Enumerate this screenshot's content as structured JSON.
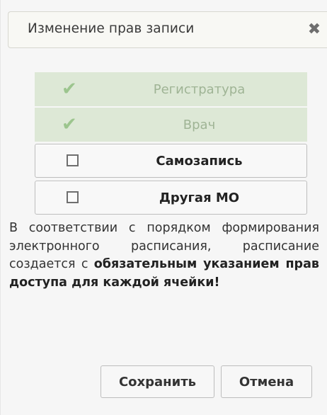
{
  "dialog": {
    "title": "Изменение прав записи",
    "close_icon": "close-icon",
    "close_glyph": "✖"
  },
  "roles": [
    {
      "label": "Регистратура",
      "checked": true,
      "enabled": false
    },
    {
      "label": "Врач",
      "checked": true,
      "enabled": false
    },
    {
      "label": "Самозапись",
      "checked": false,
      "enabled": true
    },
    {
      "label": "Другая МО",
      "checked": false,
      "enabled": true
    }
  ],
  "notice": {
    "plain": "В соответствии с порядком формирования электронного расписания, расписание создается с",
    "bold": "обязательным указанием прав доступа для каждой ячейки!"
  },
  "buttons": {
    "save_label": "Сохранить",
    "cancel_label": "Отмена"
  },
  "colors": {
    "checked_bg": "#dde8d6",
    "checked_text": "#9fb495",
    "check_mark": "#9cc58e"
  }
}
